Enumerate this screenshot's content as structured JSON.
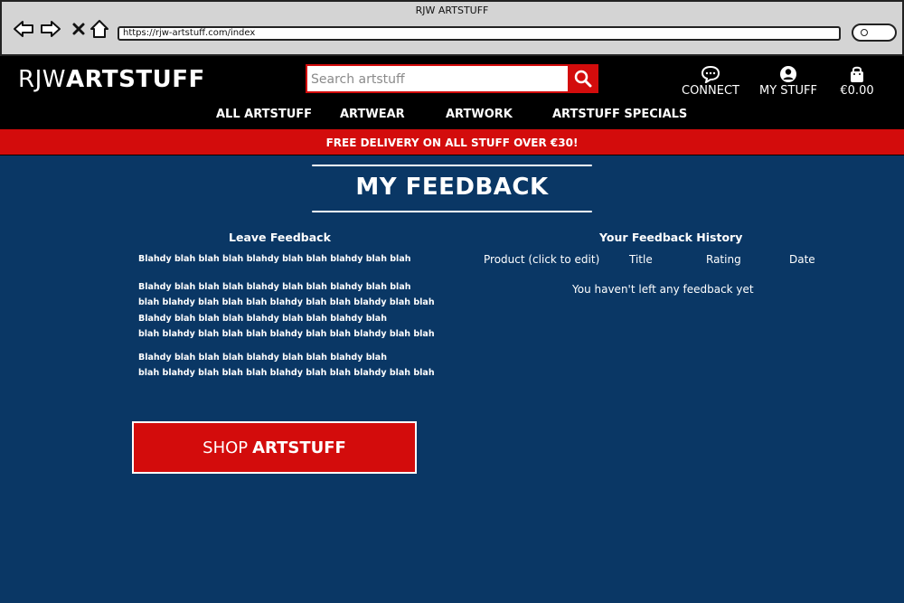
{
  "browser": {
    "title": "RJW ARTSTUFF",
    "url": "https://rjw-artstuff.com/index"
  },
  "header": {
    "logo_part1": "RJW",
    "logo_part2": "ARTSTUFF",
    "search_placeholder": "Search artstuff",
    "connect_label": "CONNECT",
    "mystuff_label": "MY STUFF",
    "basket_total": "€0.00"
  },
  "nav": {
    "items": [
      "ALL ARTSTUFF",
      "ARTWEAR",
      "ARTWORK",
      "ARTSTUFF SPECIALS"
    ]
  },
  "banner": {
    "text": "FREE DELIVERY ON ALL STUFF OVER €30!"
  },
  "page": {
    "title": "MY FEEDBACK"
  },
  "leave_feedback": {
    "heading": "Leave Feedback",
    "lines": [
      "Blahdy blah blah blah blahdy blah blah blahdy blah blah",
      "Blahdy blah blah blah blahdy blah blah blahdy blah blah",
      "blah blahdy blah blah blah blahdy blah blah blahdy blah blah",
      "Blahdy blah blah blah blahdy blah blah blahdy blah",
      "blah blahdy blah blah blah blahdy blah blah blahdy blah blah",
      "Blahdy blah blah blah blahdy blah blah blahdy blah",
      "blah blahdy blah blah blah blahdy blah blah blahdy blah blah"
    ]
  },
  "history": {
    "heading": "Your Feedback History",
    "columns": [
      "Product (click to edit)",
      "Title",
      "Rating",
      "Date"
    ],
    "empty_message": "You haven't left any feedback yet"
  },
  "shop_button": {
    "part1": "SHOP",
    "part2": "ARTSTUFF"
  },
  "colors": {
    "brand_red": "#d30c0c",
    "page_blue": "#0a3765",
    "header_black": "#000000"
  }
}
